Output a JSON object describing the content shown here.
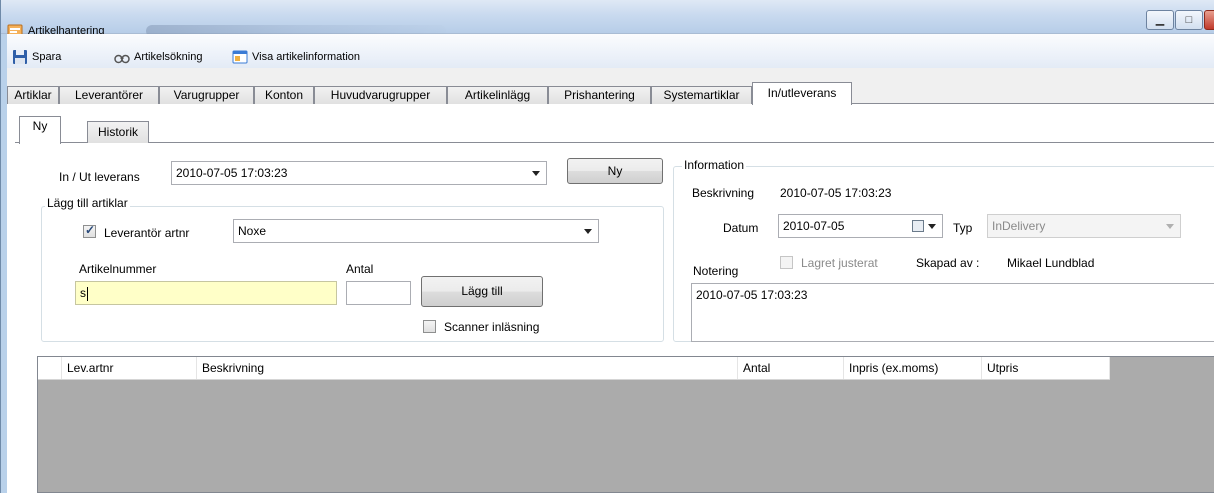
{
  "window": {
    "title": "Artikelhantering"
  },
  "toolbar": {
    "save_label": "Spara",
    "search_label": "Artikelsökning",
    "info_label": "Visa artikelinformation"
  },
  "main_tabs": [
    {
      "label": "Artiklar"
    },
    {
      "label": "Leverantörer"
    },
    {
      "label": "Varugrupper"
    },
    {
      "label": "Konton"
    },
    {
      "label": "Huvudvarugrupper"
    },
    {
      "label": "Artikelinlägg"
    },
    {
      "label": "Prishantering"
    },
    {
      "label": "Systemartiklar"
    },
    {
      "label": "In/utleverans"
    }
  ],
  "sub_tabs": [
    {
      "label": "Ny"
    },
    {
      "label": "Historik"
    }
  ],
  "delivery": {
    "label": "In / Ut leverans",
    "value": "2010-07-05 17:03:23",
    "new_button": "Ny"
  },
  "add_articles": {
    "group_title": "Lägg till artiklar",
    "supplier_checkbox_label": "Leverantör artnr",
    "supplier_value": "Noxe",
    "article_number_label": "Artikelnummer",
    "article_number_value": "s",
    "quantity_label": "Antal",
    "quantity_value": "",
    "add_button": "Lägg till",
    "scanner_label": "Scanner inläsning"
  },
  "information": {
    "group_title": "Information",
    "description_label": "Beskrivning",
    "description_value": "2010-07-05 17:03:23",
    "date_label": "Datum",
    "date_value": "2010-07-05",
    "type_label": "Typ",
    "type_value": "InDelivery",
    "note_label": "Notering",
    "stock_adjusted_label": "Lagret justerat",
    "created_by_label": "Skapad av :",
    "created_by_value": "Mikael Lundblad",
    "note_value": "2010-07-05 17:03:23"
  },
  "grid": {
    "columns": [
      {
        "label": "Lev.artnr"
      },
      {
        "label": "Beskrivning"
      },
      {
        "label": "Antal"
      },
      {
        "label": "Inpris (ex.moms)"
      },
      {
        "label": "Utpris"
      }
    ]
  }
}
